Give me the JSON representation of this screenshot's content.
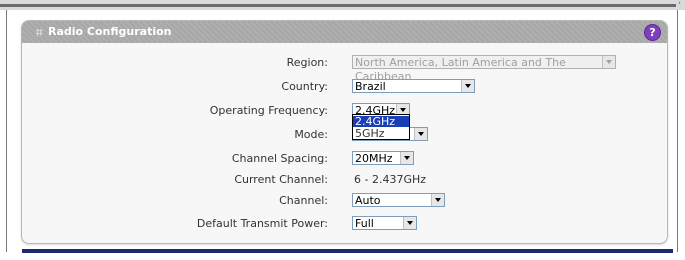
{
  "panel": {
    "title": "Radio Configuration",
    "help_glyph": "?"
  },
  "fields": {
    "region": {
      "label": "Region:",
      "value": "North America, Latin America and The Caribbean"
    },
    "country": {
      "label": "Country:",
      "value": "Brazil"
    },
    "operating_frequency": {
      "label": "Operating Frequency:",
      "value": "2.4GHz",
      "options": [
        "2.4GHz",
        "5GHz"
      ]
    },
    "mode": {
      "label": "Mode:"
    },
    "channel_spacing": {
      "label": "Channel Spacing:",
      "value": "20MHz"
    },
    "current_channel": {
      "label": "Current Channel:",
      "value": "6 - 2.437GHz"
    },
    "channel": {
      "label": "Channel:",
      "value": "Auto"
    },
    "transmit_power": {
      "label": "Default Transmit Power:",
      "value": "Full"
    }
  },
  "colors": {
    "header": "#a7a7a7",
    "help": "#7d3fbd",
    "dropdown_highlight": "#1a3eb3",
    "bottom_bar": "#1f2a6e"
  }
}
